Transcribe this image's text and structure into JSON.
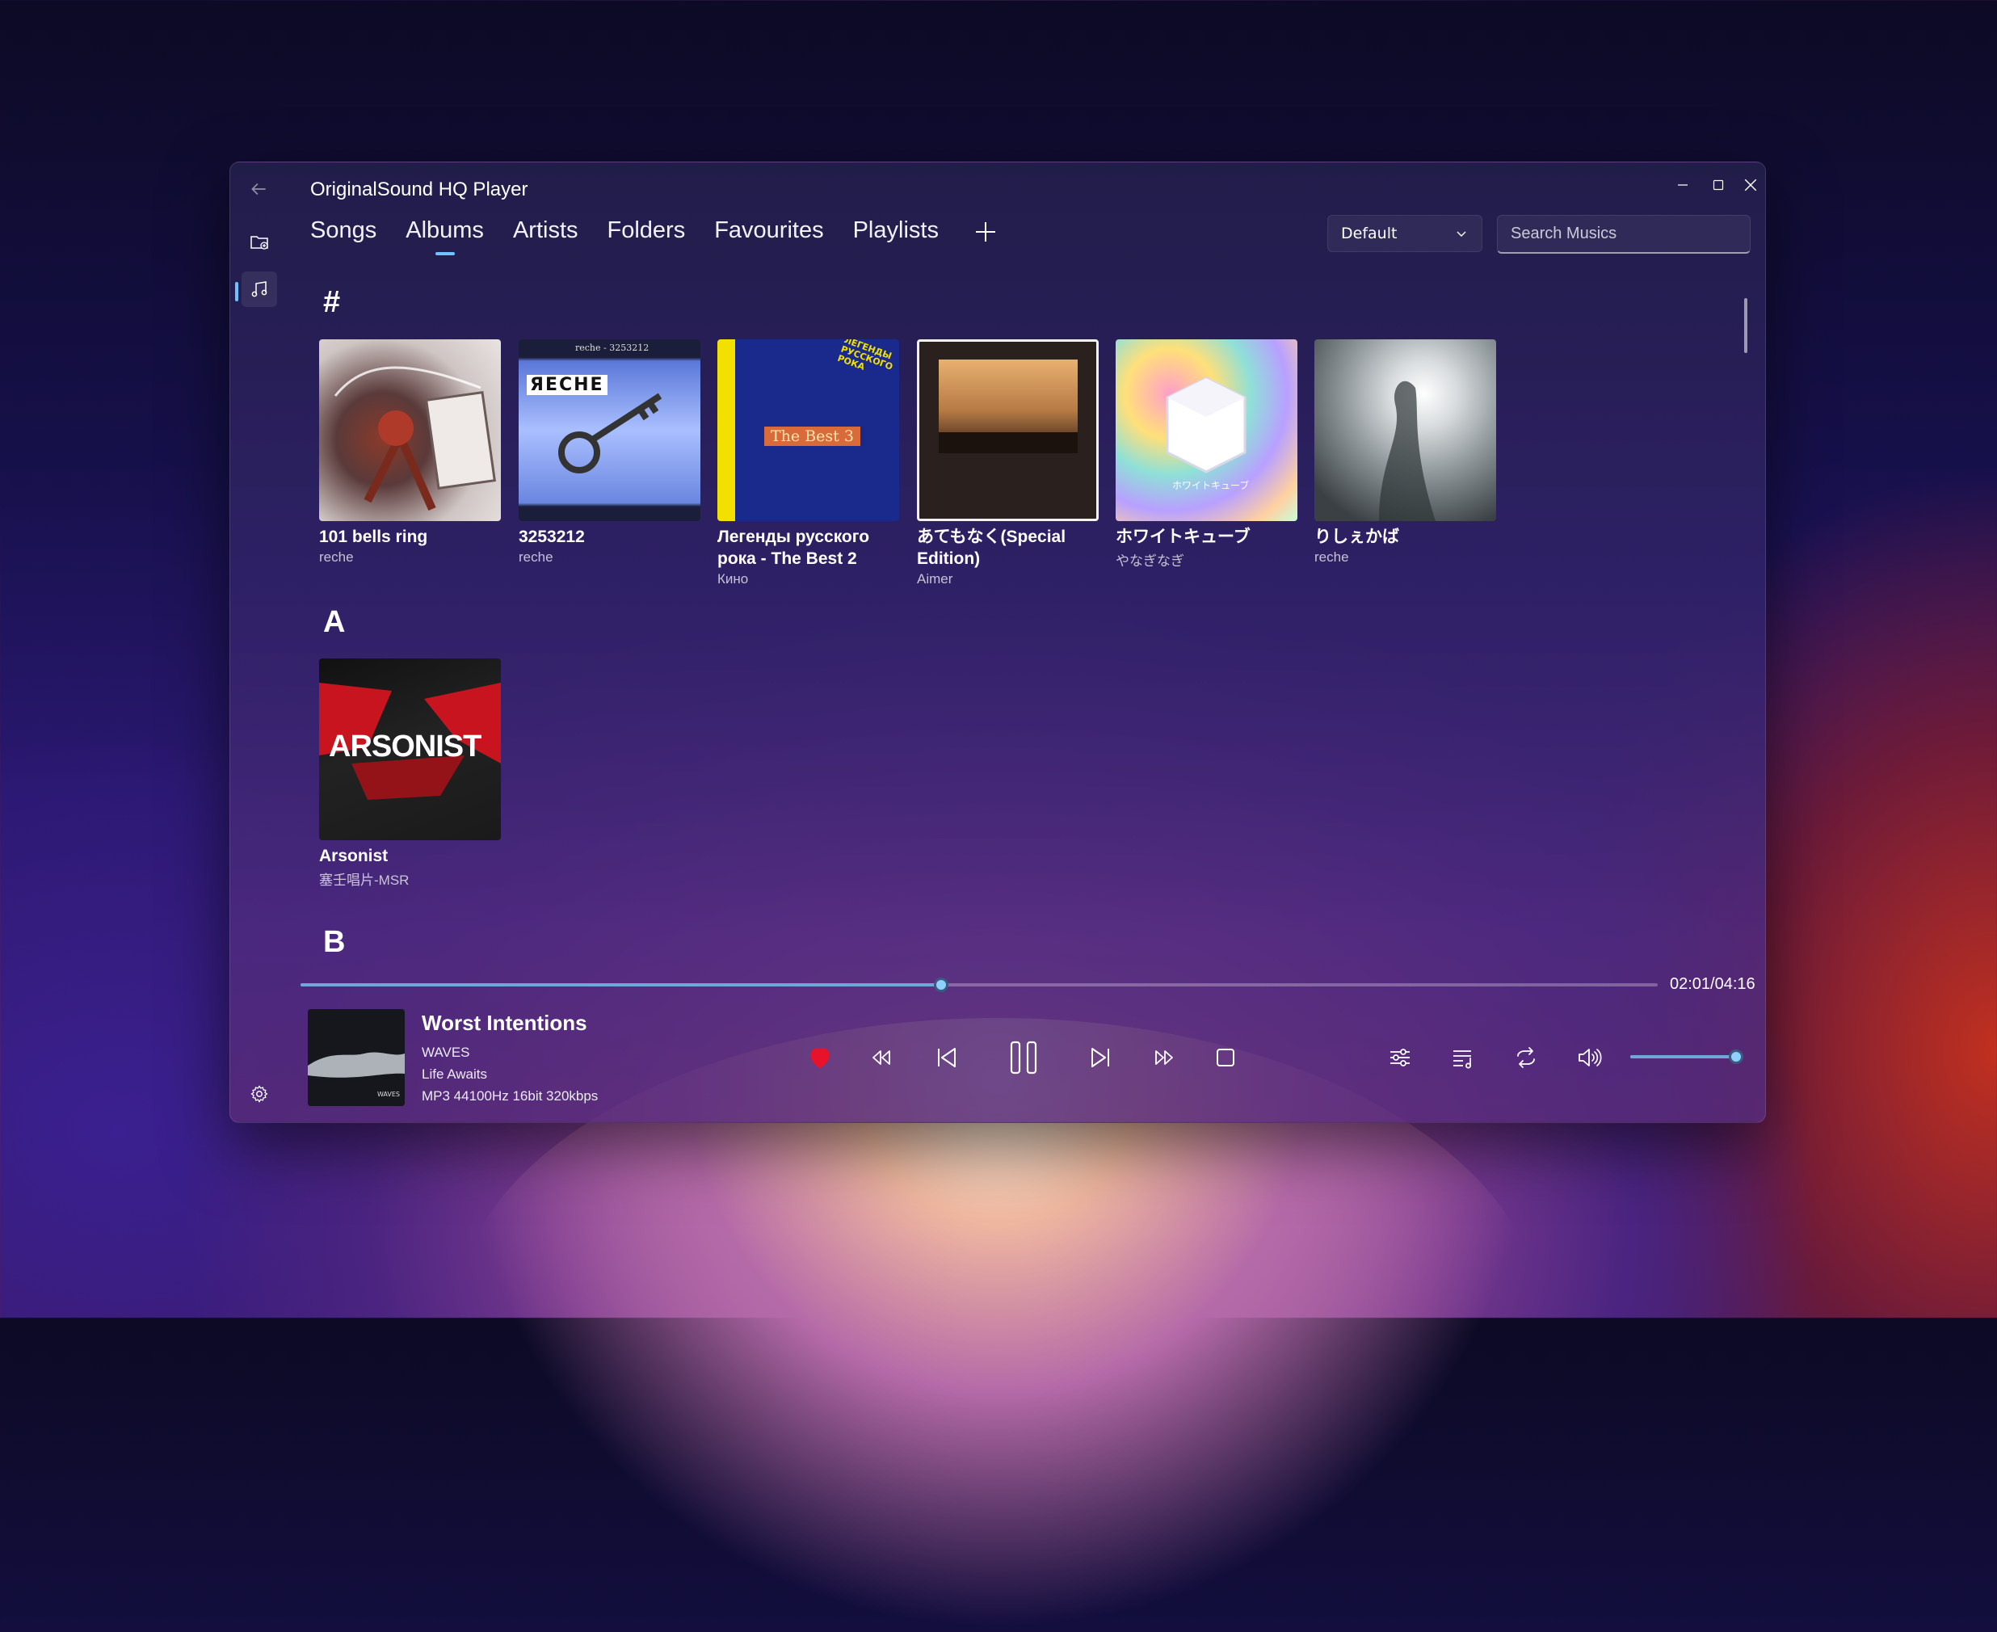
{
  "window": {
    "title": "OriginalSound HQ Player"
  },
  "tabs": [
    {
      "label": "Songs"
    },
    {
      "label": "Albums"
    },
    {
      "label": "Artists"
    },
    {
      "label": "Folders"
    },
    {
      "label": "Favourites"
    },
    {
      "label": "Playlists"
    }
  ],
  "active_tab": "Albums",
  "sort": {
    "selected": "Default"
  },
  "search": {
    "placeholder": "Search Musics"
  },
  "groups": [
    {
      "header": "#",
      "albums": [
        {
          "title": "101 bells ring",
          "artist": "reche"
        },
        {
          "title": "3253212",
          "artist": "reche"
        },
        {
          "title": "Легенды русского рока - The Best 2",
          "artist": "Кино"
        },
        {
          "title": "あてもなく(Special Edition)",
          "artist": "Aimer"
        },
        {
          "title": "ホワイトキューブ",
          "artist": "やなぎなぎ"
        },
        {
          "title": "りしぇかば",
          "artist": "reche"
        }
      ]
    },
    {
      "header": "A",
      "albums": [
        {
          "title": "Arsonist",
          "artist": "塞壬唱片-MSR"
        }
      ]
    },
    {
      "header": "B",
      "albums": []
    }
  ],
  "cover_text": {
    "c2_top": "reche - 3253212",
    "c2_word": "ЯЕСНЕ",
    "c3_badge": "The Best 3",
    "c3_side": "ЛЕГЕНДЫ РУССКОГО РОКА",
    "c5_caption": "ホワイトキューブ",
    "c7_word": "ARSONIST",
    "np_word": "WAVES"
  },
  "player": {
    "track_title": "Worst Intentions",
    "artist": "WAVES",
    "album": "Life Awaits",
    "format": "MP3 44100Hz 16bit 320kbps",
    "time": "02:01/04:16",
    "progress": 0.472,
    "volume": 0.95,
    "favourite": true,
    "accent_color": "#6fc2ff",
    "heart_color": "#e8132a"
  },
  "icons": {
    "back": "back-arrow-icon",
    "folder": "folder-icon",
    "music": "music-note-icon",
    "settings": "gear-icon"
  }
}
